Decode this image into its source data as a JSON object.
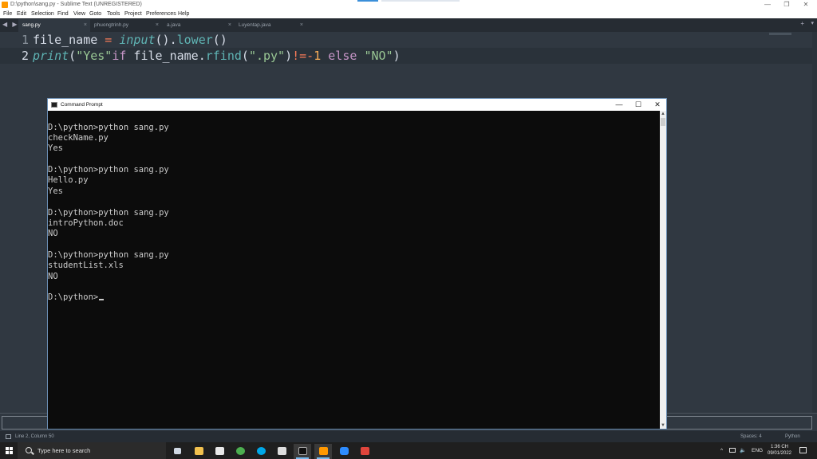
{
  "sublime": {
    "window_title": "D:\\python\\sang.py - Sublime Text (UNREGISTERED)",
    "menu": [
      "File",
      "Edit",
      "Selection",
      "Find",
      "View",
      "Goto",
      "Tools",
      "Project",
      "Preferences",
      "Help"
    ],
    "tabs": [
      {
        "label": "sang.py",
        "active": true
      },
      {
        "label": "phuongtrinh.py",
        "active": false
      },
      {
        "label": "a.java",
        "active": false
      },
      {
        "label": "Luyentap.java",
        "active": false
      }
    ],
    "tab_close_glyph": "×",
    "tab_add_glyph": "+",
    "tab_arrows": "◀ ▶",
    "gutter": [
      "1",
      "2"
    ],
    "code": {
      "line1": {
        "ident": "file_name",
        "eq": " = ",
        "fn": "input",
        "mid": "().",
        "method": "lower",
        "tail": "()"
      },
      "line2": {
        "fn": "print",
        "p1": "(",
        "s1": "\"Yes\"",
        "kw_if": "if",
        "ident": " file_name.",
        "method": "rfind",
        "p2": "(",
        "s2": "\".py\"",
        "p3": ")",
        "op": "!=-",
        "num": "1",
        "kw_else": " else ",
        "s3": "\"NO\"",
        "p4": ")"
      }
    },
    "status": {
      "position": "Line 2, Column 50",
      "spaces": "Spaces: 4",
      "syntax": "Python"
    }
  },
  "cmd": {
    "title": "Command Prompt",
    "lines": [
      "",
      "D:\\python>python sang.py",
      "checkName.py",
      "Yes",
      "",
      "D:\\python>python sang.py",
      "Hello.py",
      "Yes",
      "",
      "D:\\python>python sang.py",
      "introPython.doc",
      "NO",
      "",
      "D:\\python>python sang.py",
      "studentList.xls",
      "NO",
      "",
      "D:\\python>"
    ],
    "controls": {
      "minimize": "—",
      "maximize": "☐",
      "close": "✕"
    }
  },
  "taskbar": {
    "search_placeholder": "Type here to search",
    "apps": [
      {
        "name": "task-view",
        "color": "#cfd8e3"
      },
      {
        "name": "file-explorer",
        "color": "#f2c14e"
      },
      {
        "name": "microsoft-store",
        "color": "#e8e8e8"
      },
      {
        "name": "chrome",
        "color": "#4caf50"
      },
      {
        "name": "skype",
        "color": "#00a8e8"
      },
      {
        "name": "app-grid",
        "color": "#dddddd"
      },
      {
        "name": "command-prompt",
        "color": "#101010"
      },
      {
        "name": "sublime-text",
        "color": "#ff9800"
      },
      {
        "name": "zoom",
        "color": "#2d8cff"
      },
      {
        "name": "pycharm",
        "color": "#e0453c"
      }
    ],
    "tray": {
      "chevron": "^",
      "lang": "ENG",
      "time": "1:36 CH",
      "date": "09/01/2022"
    }
  }
}
